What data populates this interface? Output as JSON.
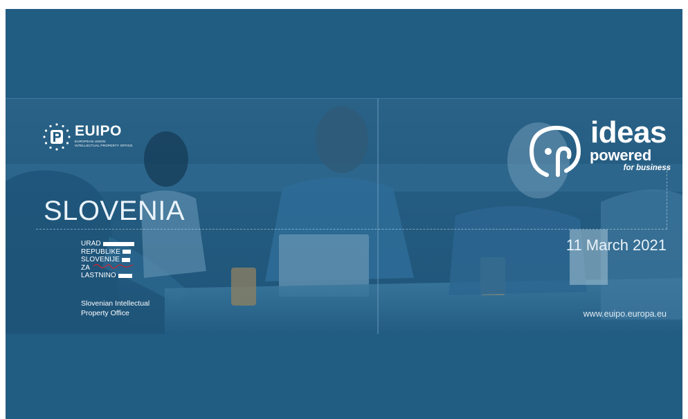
{
  "brand": {
    "euipo_name": "EUIPO",
    "euipo_subtitle_1": "EUROPEAN UNION",
    "euipo_subtitle_2": "INTELLECTUAL PROPERTY OFFICE"
  },
  "event": {
    "country": "SLOVENIA",
    "date": "11 March 2021",
    "website": "www.euipo.europa.eu"
  },
  "campaign": {
    "line1": "ideas",
    "line2": "powered",
    "line3": "for business"
  },
  "partner": {
    "logo_lines": [
      "URAD",
      "REPUBLIKE",
      "SLOVENIJE",
      "ZA",
      "LASTNINO"
    ],
    "name_line1": "Slovenian Intellectual",
    "name_line2": "Property Office"
  },
  "colors": {
    "background": "#215c82",
    "text": "#ffffff",
    "signature": "#d3232a"
  }
}
